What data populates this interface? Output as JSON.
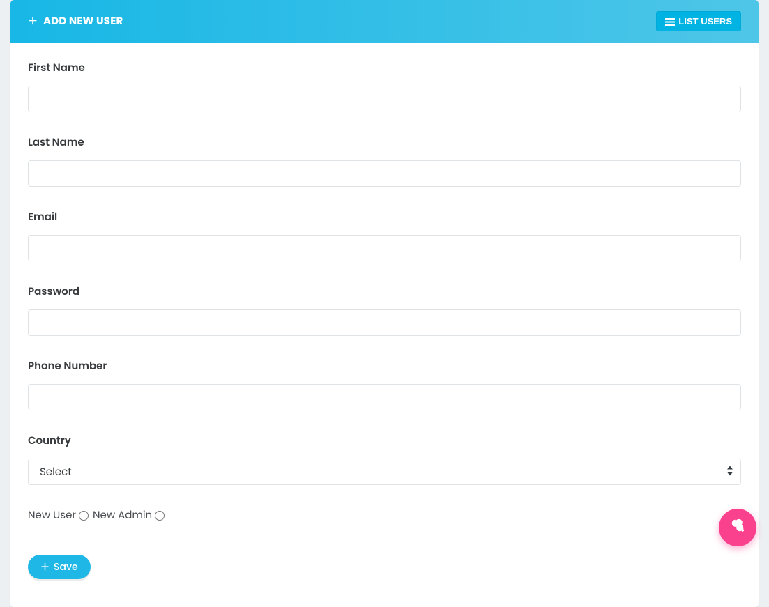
{
  "header": {
    "title": "ADD NEW USER",
    "list_users_label": "LIST USERS"
  },
  "form": {
    "first_name": {
      "label": "First Name",
      "value": ""
    },
    "last_name": {
      "label": "Last Name",
      "value": ""
    },
    "email": {
      "label": "Email",
      "value": ""
    },
    "password": {
      "label": "Password",
      "value": ""
    },
    "phone": {
      "label": "Phone Number",
      "value": ""
    },
    "country": {
      "label": "Country",
      "selected": "Select"
    },
    "role": {
      "new_user_label": "New User",
      "new_admin_label": "New Admin"
    },
    "save_label": "Save"
  }
}
